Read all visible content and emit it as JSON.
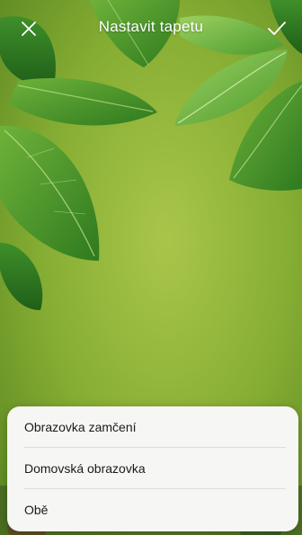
{
  "header": {
    "title": "Nastavit tapetu",
    "close_icon": "close-icon",
    "confirm_icon": "checkmark-icon"
  },
  "wallpaper": {
    "description_icon": "green-leaves-wallpaper",
    "background_color": "#8db33a"
  },
  "sheet": {
    "options": [
      {
        "label": "Obrazovka zamčení"
      },
      {
        "label": "Domovská obrazovka"
      },
      {
        "label": "Obě"
      }
    ]
  }
}
